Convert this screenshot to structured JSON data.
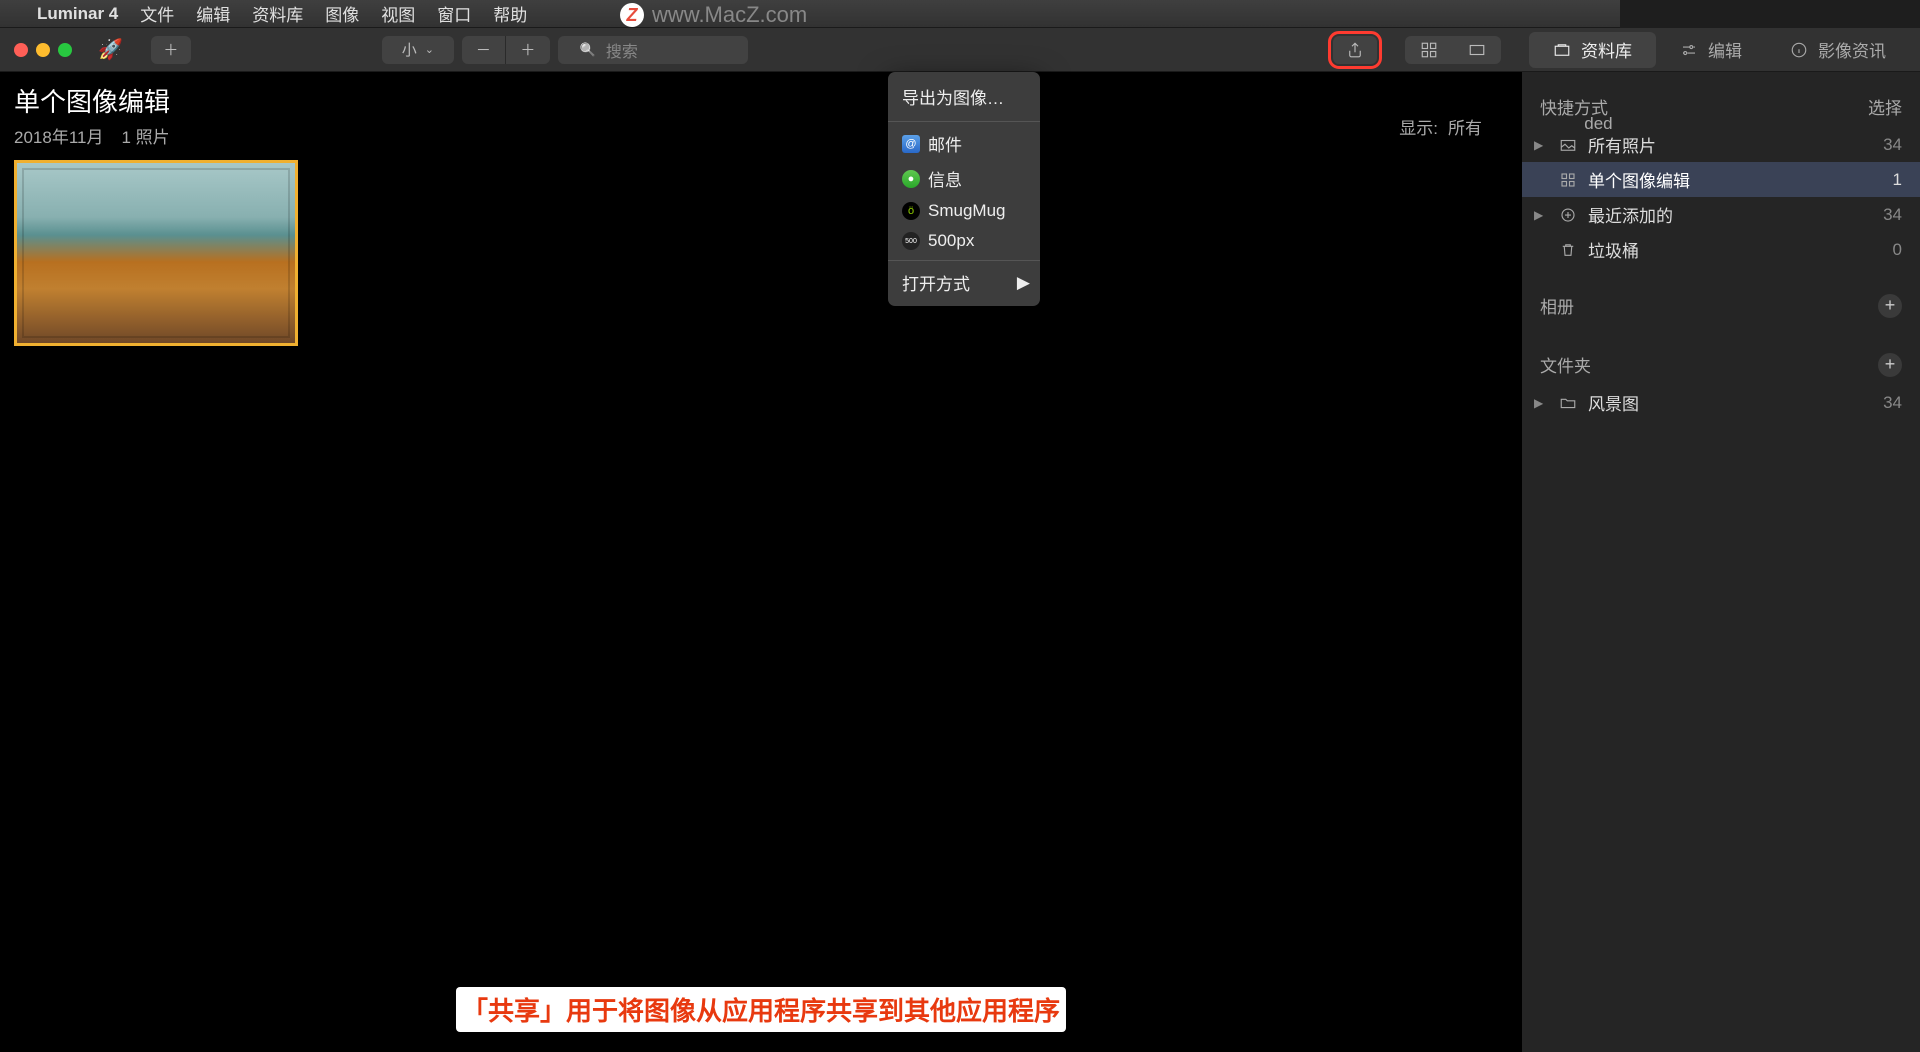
{
  "menubar": {
    "app": "Luminar 4",
    "items": [
      "文件",
      "编辑",
      "资料库",
      "图像",
      "视图",
      "窗口",
      "帮助"
    ]
  },
  "watermark": "www.MacZ.com",
  "toolbar": {
    "size_label": "小",
    "search_placeholder": "搜索",
    "tabs": {
      "library": "资料库",
      "edit": "编辑",
      "info": "影像资讯"
    }
  },
  "content": {
    "title": "单个图像编辑",
    "date": "2018年11月",
    "count": "1 照片",
    "display_label": "显示:",
    "display_value": "所有",
    "display_trail": "ded"
  },
  "share_menu": {
    "export": "导出为图像…",
    "mail": "邮件",
    "messages": "信息",
    "smugmug": "SmugMug",
    "px500": "500px",
    "openwith": "打开方式"
  },
  "sidebar": {
    "shortcuts_hdr": "快捷方式",
    "select_label": "选择",
    "items": {
      "all_photos": {
        "label": "所有照片",
        "count": 34
      },
      "single_edit": {
        "label": "单个图像编辑",
        "count": 1
      },
      "recent": {
        "label": "最近添加的",
        "count": 34
      },
      "trash": {
        "label": "垃圾桶",
        "count": 0
      }
    },
    "albums_hdr": "相册",
    "folders_hdr": "文件夹",
    "folders": {
      "landscape": {
        "label": "风景图",
        "count": 34
      }
    }
  },
  "caption": "「共享」用于将图像从应用程序共享到其他应用程序"
}
